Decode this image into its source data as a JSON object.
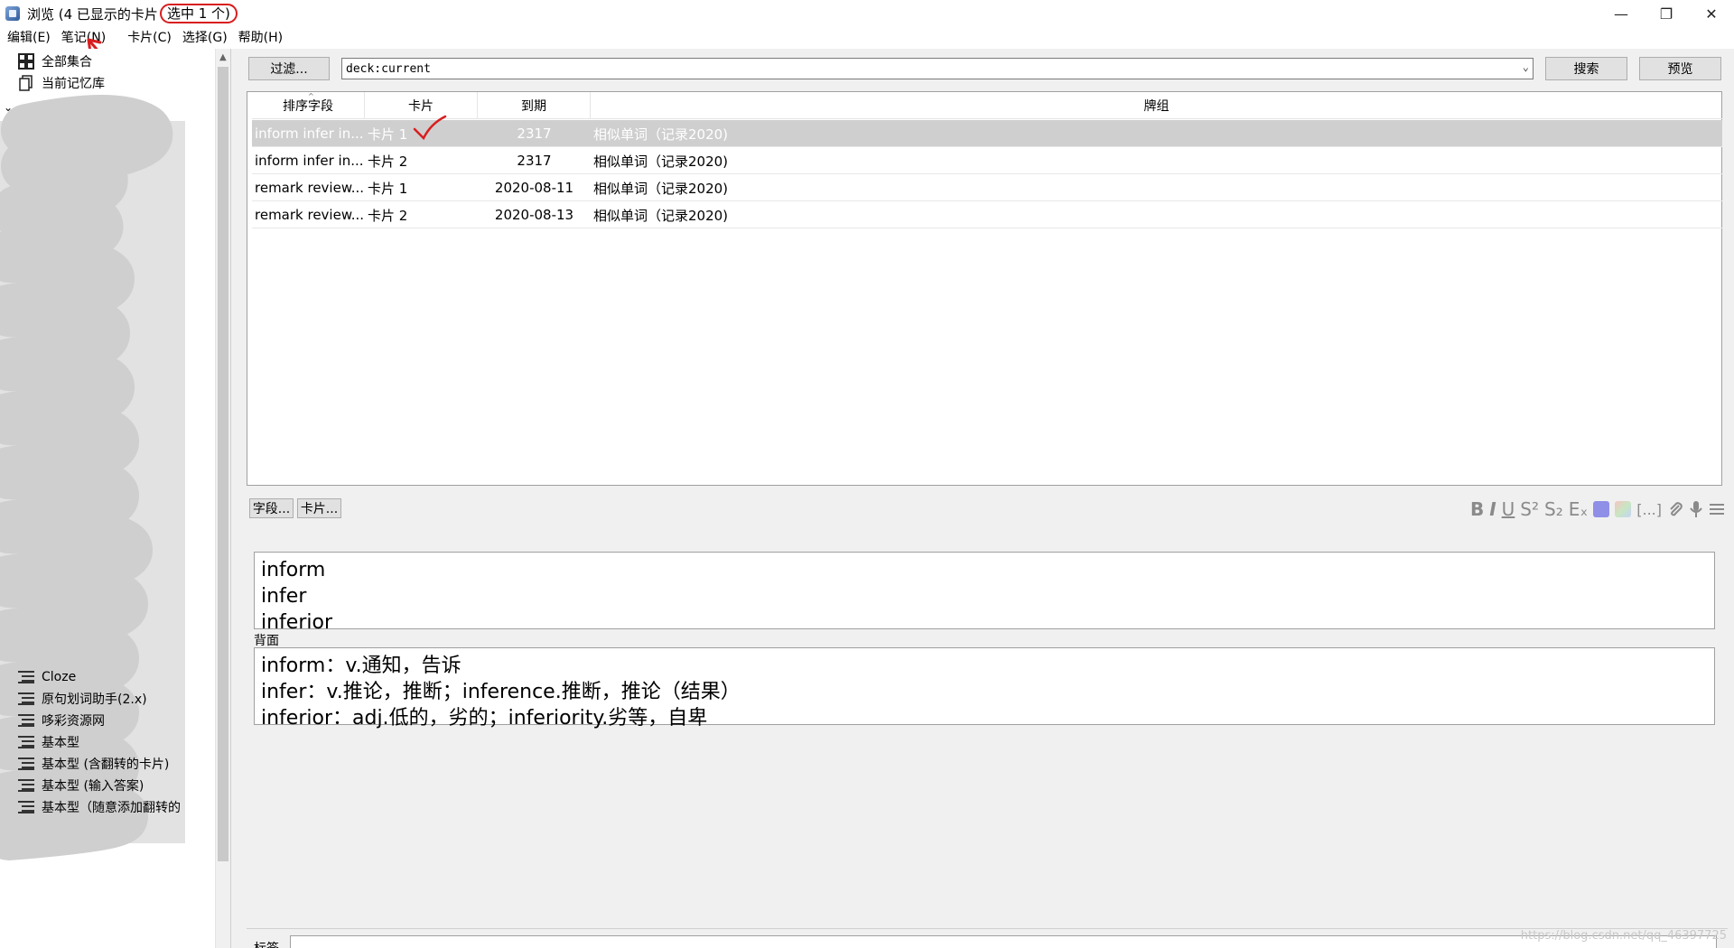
{
  "window": {
    "title": "浏览 (4 已显示的卡片",
    "title_selected": "选中 1 个)",
    "minimize": "—",
    "maximize": "❐",
    "close": "✕"
  },
  "menu": [
    "编辑(E)",
    "笔记(N)",
    "卡片(C)",
    "选择(G)",
    "帮助(H)"
  ],
  "sidebar": {
    "top_items": [
      {
        "label": "全部集合",
        "icon": "cards-stack-icon"
      },
      {
        "label": "当前记忆库",
        "icon": "deck-icon"
      }
    ],
    "note_types": [
      "Cloze",
      "原句划词助手(2.x)",
      "哆彩资源网",
      "基本型",
      "基本型 (含翻转的卡片)",
      "基本型 (输入答案)",
      "基本型（随意添加翻转的"
    ]
  },
  "toolbar": {
    "filter_button": "过滤...",
    "search_query": "deck:current",
    "search_button": "搜索",
    "preview_button": "预览"
  },
  "table": {
    "columns": [
      "排序字段",
      "卡片",
      "到期",
      "牌组"
    ],
    "rows": [
      {
        "sort_field": "inform infer in...",
        "card": "卡片 1",
        "due": "2317",
        "deck": "相似单词（记录2020)",
        "selected": true
      },
      {
        "sort_field": "inform infer in...",
        "card": "卡片 2",
        "due": "2317",
        "deck": "相似单词（记录2020)",
        "selected": false
      },
      {
        "sort_field": "remark review...",
        "card": "卡片 1",
        "due": "2020-08-11",
        "deck": "相似单词（记录2020)",
        "selected": false
      },
      {
        "sort_field": "remark review...",
        "card": "卡片 2",
        "due": "2020-08-13",
        "deck": "相似单词（记录2020)",
        "selected": false
      }
    ]
  },
  "editor": {
    "fields_button": "字段...",
    "cards_button": "卡片...",
    "format_tools": [
      "B",
      "I",
      "U",
      "S²",
      "S₂",
      "Eₓ"
    ],
    "swatch_colors": [
      "#8f8fe8",
      "#c9e6c1"
    ],
    "front_lines": [
      "inform",
      "infer",
      "inferior"
    ],
    "back_label": "背面",
    "back_lines": [
      {
        "en": "inform：v.",
        "cn": "通知，告诉"
      },
      {
        "en": "infer：v.",
        "cn": "推论，推断；",
        "en2": "inference.",
        "cn2": "推断，推论（结果）"
      },
      {
        "en": "inferior：adj.",
        "cn": "低的，劣的；",
        "en2": "inferiority.",
        "cn2": "劣等，自卑"
      }
    ],
    "tags_label": "标签",
    "watermark": "https://blog.csdn.net/qq_46397725"
  },
  "colors": {
    "annotation_red": "#d81e1e",
    "selected_row": "#cfcfcf"
  }
}
